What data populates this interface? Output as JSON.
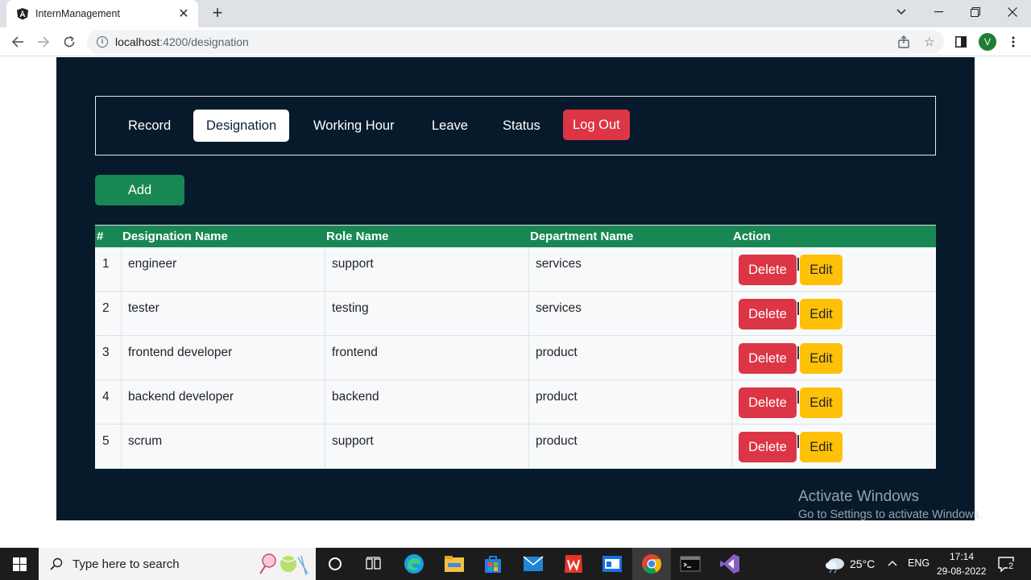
{
  "browser": {
    "tab_title": "InternManagement",
    "url_host": "localhost",
    "url_path": ":4200/designation",
    "profile_initial": "V"
  },
  "nav": {
    "items": [
      {
        "label": "Record",
        "active": false
      },
      {
        "label": "Designation",
        "active": true
      },
      {
        "label": "Working Hour",
        "active": false
      },
      {
        "label": "Leave",
        "active": false
      },
      {
        "label": "Status",
        "active": false
      }
    ],
    "logout_label": "Log Out"
  },
  "add_label": "Add",
  "table": {
    "headers": [
      "#",
      "Designation Name",
      "Role Name",
      "Department Name",
      "Action"
    ],
    "rows": [
      {
        "num": "1",
        "designation": "engineer",
        "role": "support",
        "department": "services"
      },
      {
        "num": "2",
        "designation": "tester",
        "role": "testing",
        "department": "services"
      },
      {
        "num": "3",
        "designation": "frontend developer",
        "role": "frontend",
        "department": "product"
      },
      {
        "num": "4",
        "designation": "backend developer",
        "role": "backend",
        "department": "product"
      },
      {
        "num": "5",
        "designation": "scrum",
        "role": "support",
        "department": "product"
      }
    ],
    "delete_label": "Delete",
    "edit_label": "Edit"
  },
  "watermark": {
    "line1": "Activate Windows",
    "line2": "Go to Settings to activate Windows."
  },
  "taskbar": {
    "search_placeholder": "Type here to search",
    "temperature": "25°C",
    "language": "ENG",
    "time": "17:14",
    "date": "29-08-2022",
    "notification_count": "2"
  },
  "colors": {
    "page_bg": "#061a2c",
    "success": "#198754",
    "danger": "#dc3545",
    "warning": "#ffc107"
  }
}
